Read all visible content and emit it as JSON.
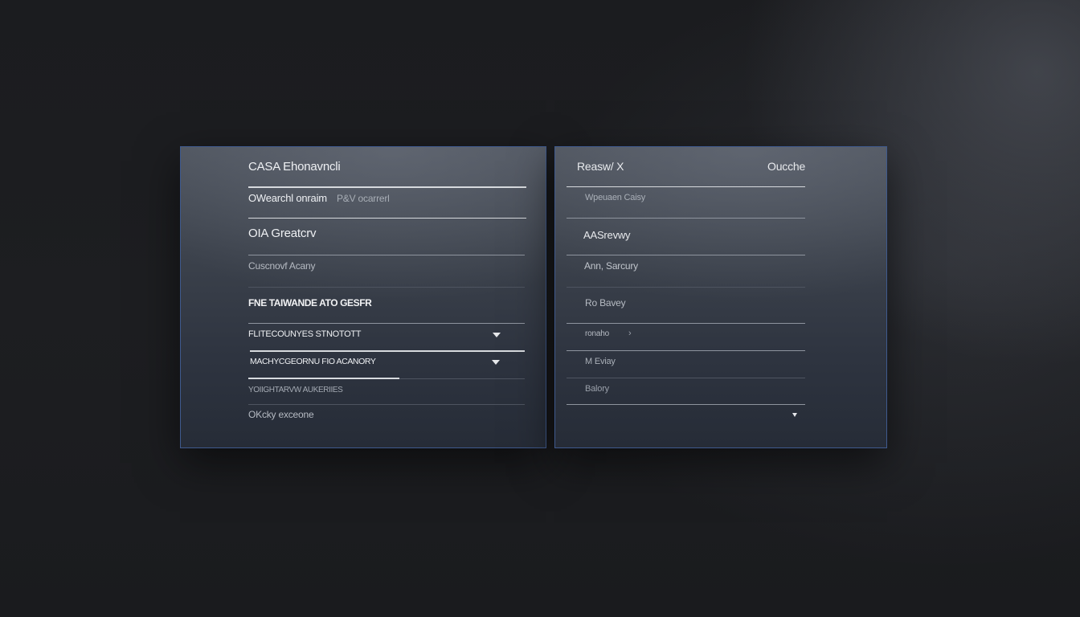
{
  "left_panel": {
    "title": "CASA Ehonavncli",
    "row1_label": "OWearchl onraim",
    "row1_value": "P&V ocarrerl",
    "row2_label": "OIA Greatcrv",
    "row3_label": "Cuscnovf Acany",
    "section_heading": "FNE TAIWANDE ATO GESFR",
    "select1_value": "FLITECOUNYES STNOTOTT",
    "select2_value": "MACHYCGEORNU FIO ACANORY",
    "row4_label": "YOIIGHTARVW  AUKERIIES",
    "row5_label": "OKcky exceone"
  },
  "right_panel": {
    "header_left": "Reasw/ X",
    "header_right": "Oucche",
    "row1_label": "Wpeuaen Caisy",
    "row2_label": "AASrevwy",
    "row3_label": "Ann, Sarcury",
    "row4_label": "Ro Bavey",
    "row5_label": "ronaho",
    "row6_label": "M Eviay",
    "row7_label": "Balory"
  },
  "icons": {
    "dropdown": "chevron-down-icon"
  },
  "colors": {
    "accent_border": "#3f5a8e",
    "panel_top": "#4d535d",
    "panel_bottom": "#262c37",
    "background": "#1c1d20"
  }
}
